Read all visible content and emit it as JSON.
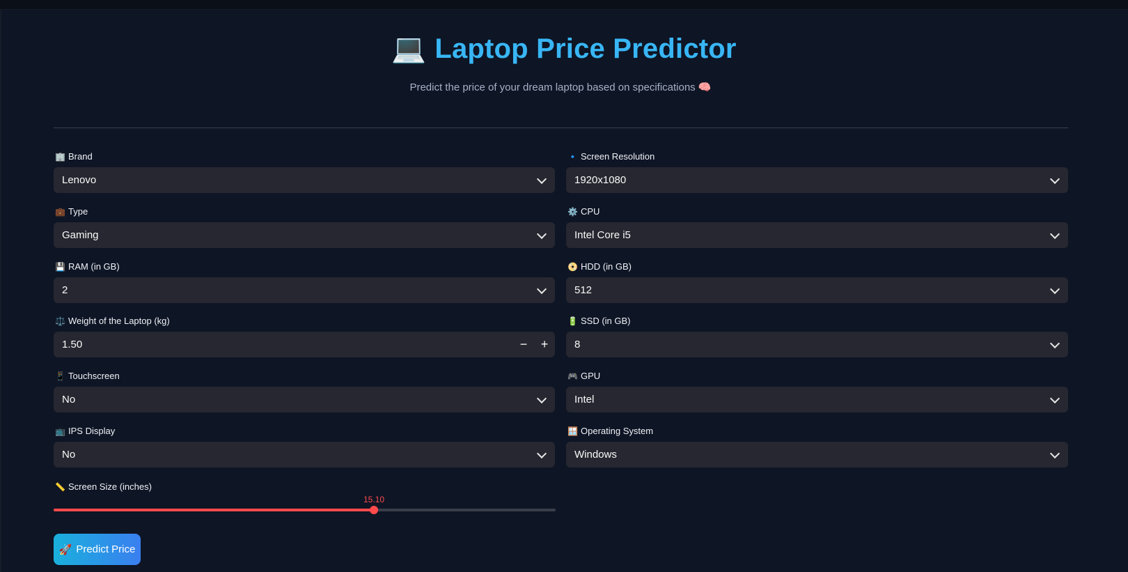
{
  "header": {
    "title_emoji": "💻",
    "title": "Laptop Price Predictor",
    "subtitle": "Predict the price of your dream laptop based on specifications 🧠"
  },
  "fields": {
    "brand": {
      "icon": "🏢",
      "label": "Brand",
      "value": "Lenovo"
    },
    "type": {
      "icon": "💼",
      "label": "Type",
      "value": "Gaming"
    },
    "ram": {
      "icon": "💾",
      "label": "RAM (in GB)",
      "value": "2"
    },
    "weight": {
      "icon": "⚖️",
      "label": "Weight of the Laptop (kg)",
      "value": "1.50"
    },
    "touchscreen": {
      "icon": "📱",
      "label": "Touchscreen",
      "value": "No"
    },
    "ips": {
      "icon": "📺",
      "label": "IPS Display",
      "value": "No"
    },
    "screen_res": {
      "icon": "🔹",
      "label": "Screen Resolution",
      "value": "1920x1080"
    },
    "cpu": {
      "icon": "⚙️",
      "label": "CPU",
      "value": "Intel Core i5"
    },
    "hdd": {
      "icon": "📀",
      "label": "HDD (in GB)",
      "value": "512"
    },
    "ssd": {
      "icon": "🔋",
      "label": "SSD (in GB)",
      "value": "8"
    },
    "gpu": {
      "icon": "🎮",
      "label": "GPU",
      "value": "Intel"
    },
    "os": {
      "icon": "🪟",
      "label": "Operating System",
      "value": "Windows"
    }
  },
  "screen_size": {
    "icon": "📏",
    "label": "Screen Size (inches)",
    "value": "15.10",
    "fraction": 0.638
  },
  "predict_button": {
    "icon": "🚀",
    "label": "Predict Price"
  },
  "colors": {
    "background": "#0e1525",
    "accent_title": "#38b6f5",
    "slider": "#ff4b4b",
    "input_bg": "#262730"
  }
}
